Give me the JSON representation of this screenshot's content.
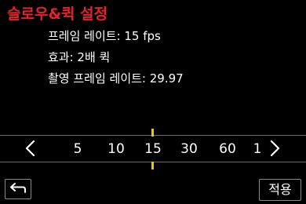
{
  "header": {
    "title": "슬로우&퀵 설정"
  },
  "info": {
    "line1": "프레임 레이트: 15 fps",
    "line2": "효과: 2배 퀵",
    "line3": "촬영 프레임 레이트: 29.97"
  },
  "selector": {
    "values": [
      "5",
      "10",
      "15",
      "30",
      "60",
      "1"
    ],
    "selected": "15",
    "left_icon": "chevron-left-icon",
    "right_icon": "chevron-right-icon",
    "marker_color": "#f5c400"
  },
  "footer": {
    "back_icon": "return-arrow-icon",
    "apply_label": "적용"
  },
  "colors": {
    "title": "#e8202a",
    "background": "#000000",
    "text": "#ffffff"
  }
}
